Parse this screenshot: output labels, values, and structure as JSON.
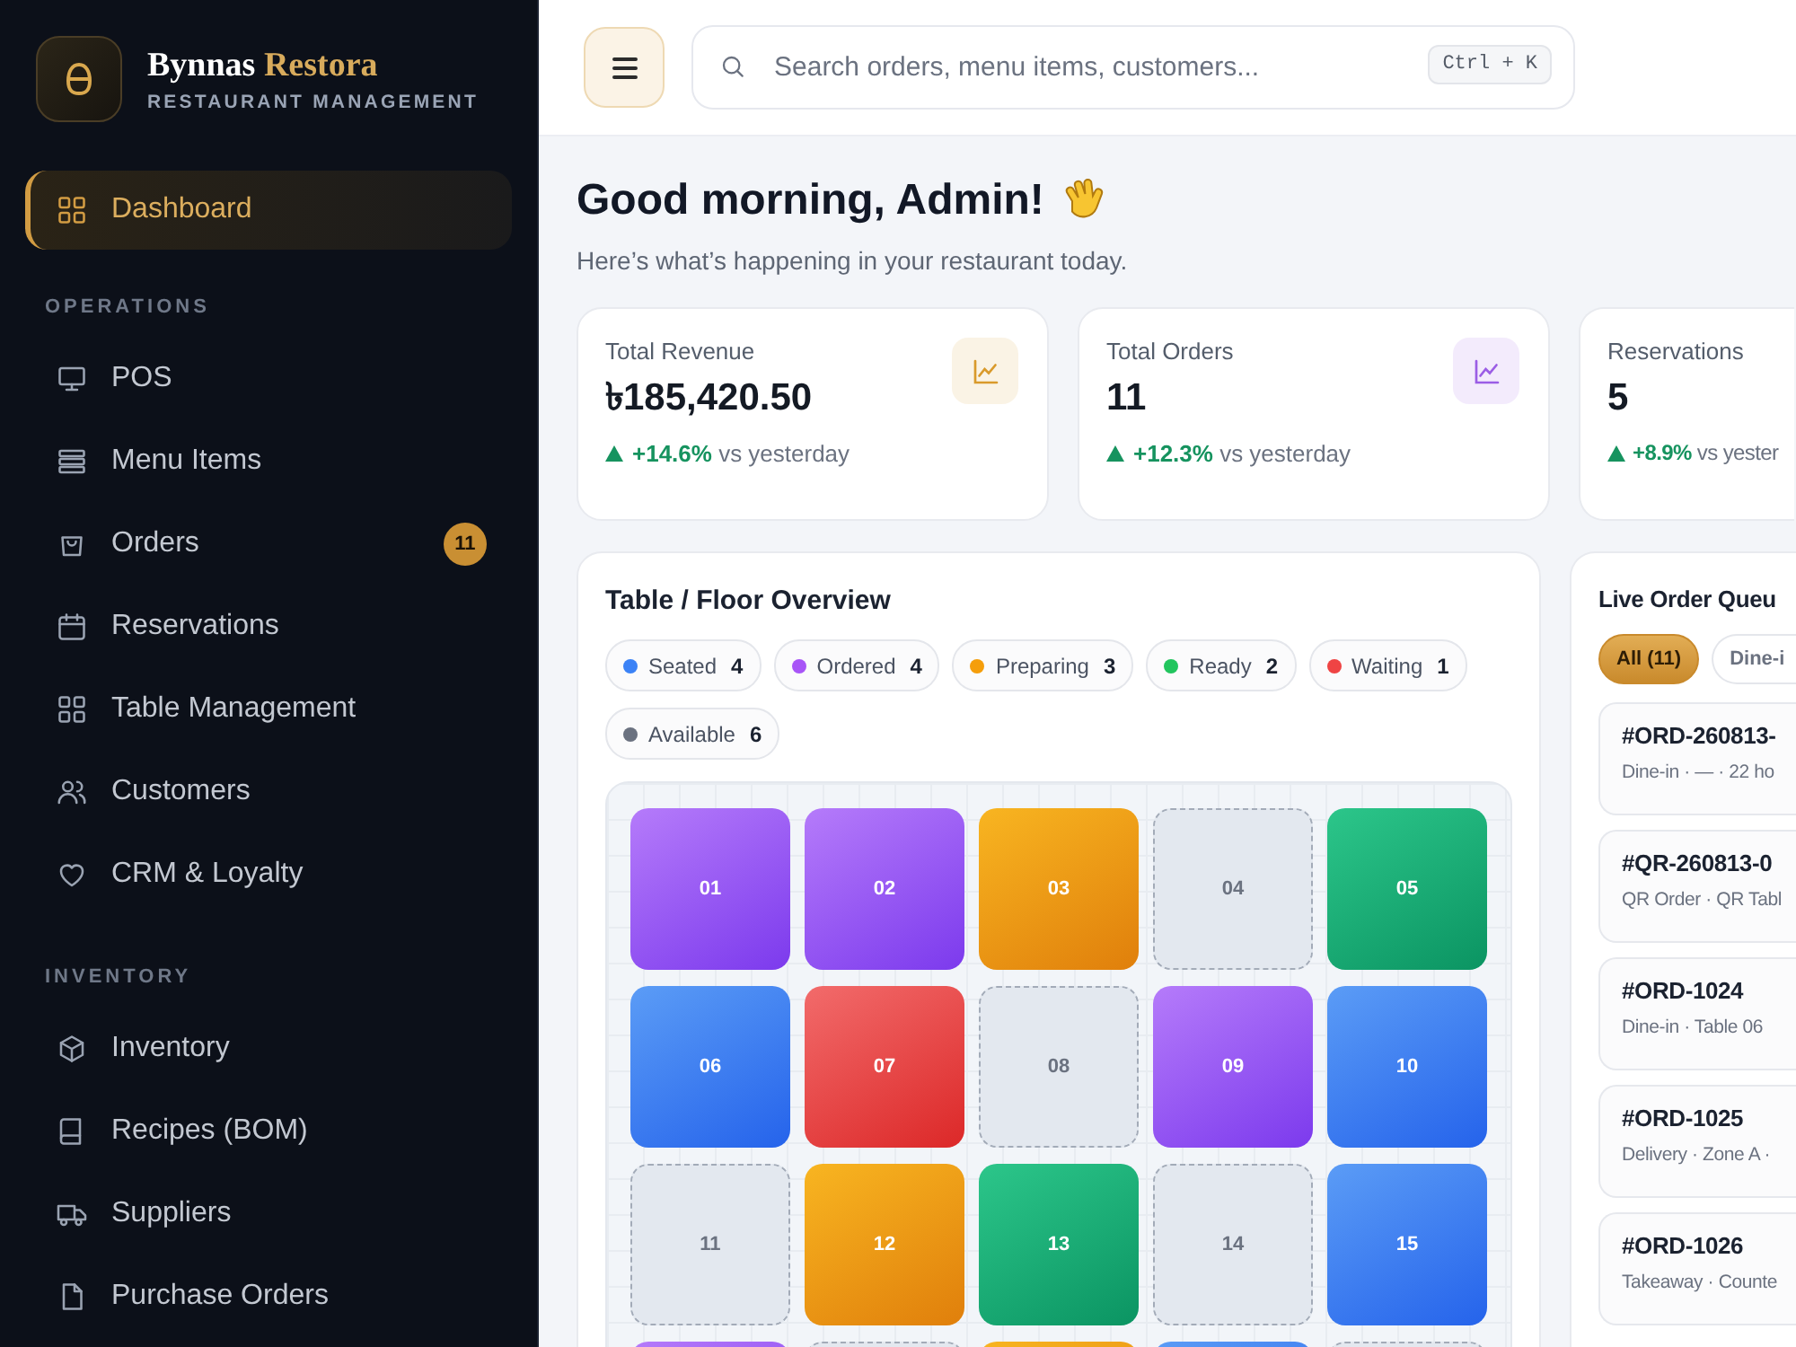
{
  "sidebar": {
    "brand": {
      "name": "Bynnas",
      "accent": "Restora",
      "tagline": "RESTAURANT MANAGEMENT"
    },
    "nav": [
      {
        "label": "Dashboard",
        "selected": true
      }
    ],
    "sections": [
      {
        "title": "OPERATIONS",
        "items": [
          {
            "label": "POS",
            "selected": false
          },
          {
            "label": "Menu Items",
            "selected": false
          },
          {
            "label": "Orders",
            "selected": false,
            "badge": "11"
          },
          {
            "label": "Reservations",
            "selected": false
          },
          {
            "label": "Table Management",
            "selected": false
          },
          {
            "label": "Customers",
            "selected": false
          },
          {
            "label": "CRM & Loyalty",
            "selected": false
          }
        ]
      },
      {
        "title": "INVENTORY",
        "items": [
          {
            "label": "Inventory",
            "selected": false
          },
          {
            "label": "Recipes (BOM)",
            "selected": false
          },
          {
            "label": "Suppliers",
            "selected": false
          },
          {
            "label": "Purchase Orders",
            "selected": false
          }
        ]
      }
    ]
  },
  "topbar": {
    "search": {
      "placeholder": "Search orders, menu items, customers..."
    },
    "shortcut": "Ctrl + K"
  },
  "greeting": {
    "title": "Good morning, Admin!",
    "subtitle": "Here’s what’s happening in your restaurant today."
  },
  "stats": [
    {
      "title": "Total Revenue",
      "value": "৳185,420.50",
      "change": "**+14.6%** vs yesterday",
      "color": "#d99a2b"
    },
    {
      "title": "Total Orders",
      "value": "11",
      "change": "**+12.3%** vs yesterday",
      "color": "#9b5de5"
    },
    {
      "title": "Reservations",
      "value": "5",
      "change": "**+8.9%** vs yester"
    }
  ],
  "floor": {
    "title": "Table / Floor Overview",
    "legend": [
      {
        "label": "Seated",
        "count": "4",
        "color": "#3b82f6"
      },
      {
        "label": "Ordered",
        "count": "4",
        "color": "#a855f7"
      },
      {
        "label": "Preparing",
        "count": "3",
        "color": "#f59e0b"
      },
      {
        "label": "Ready",
        "count": "2",
        "color": "#22c55e"
      },
      {
        "label": "Waiting",
        "count": "1",
        "color": "#ef4444"
      },
      {
        "label": "Available",
        "count": "6",
        "color": "#6b7280"
      }
    ],
    "tables": [
      {
        "label": "01",
        "kind": "ordered"
      },
      {
        "label": "02",
        "kind": "ordered"
      },
      {
        "label": "03",
        "kind": "preparing"
      },
      {
        "label": "04",
        "kind": "available"
      },
      {
        "label": "05",
        "kind": "ready"
      },
      {
        "label": "06",
        "kind": "seated"
      },
      {
        "label": "07",
        "kind": "waiting"
      },
      {
        "label": "08",
        "kind": "available"
      },
      {
        "label": "09",
        "kind": "ordered"
      },
      {
        "label": "10",
        "kind": "seated"
      },
      {
        "label": "11",
        "kind": "available"
      },
      {
        "label": "12",
        "kind": "preparing"
      },
      {
        "label": "13",
        "kind": "ready"
      },
      {
        "label": "14",
        "kind": "available"
      },
      {
        "label": "15",
        "kind": "seated"
      },
      {
        "kind": "ordered"
      },
      {
        "kind": "available"
      },
      {
        "kind": "preparing"
      },
      {
        "kind": "seated"
      },
      {
        "kind": "available"
      }
    ]
  },
  "queue": {
    "title": "Live Order Queu",
    "tabs": [
      {
        "label": "All (11)",
        "selected": true
      },
      {
        "label": "Dine-i",
        "selected": false
      }
    ],
    "orders": [
      {
        "id": "#ORD-260813-",
        "meta": "Dine-in · — · 22 ho"
      },
      {
        "id": "#QR-260813-0",
        "meta": "QR Order · QR Tabl"
      },
      {
        "id": "#ORD-1024",
        "meta": "Dine-in · Table 06"
      },
      {
        "id": "#ORD-1025",
        "meta": "Delivery · Zone A ·"
      },
      {
        "id": "#ORD-1026",
        "meta": "Takeaway · Counte"
      }
    ]
  }
}
